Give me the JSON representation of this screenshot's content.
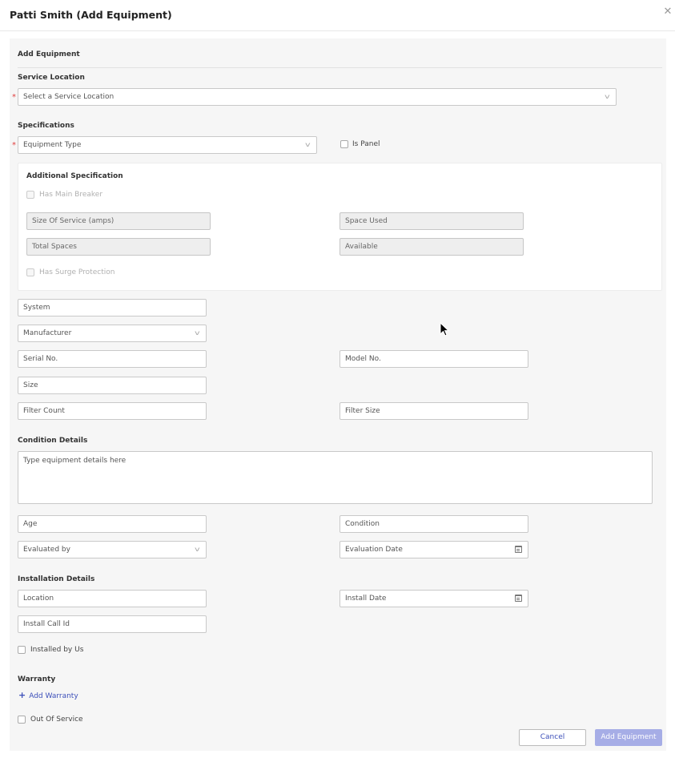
{
  "header": {
    "title": "Patti Smith (Add Equipment)"
  },
  "form": {
    "section_add": "Add Equipment",
    "service_location": {
      "label": "Service Location",
      "placeholder": "Select a Service Location"
    },
    "specifications": {
      "label": "Specifications",
      "equipment_type": "Equipment Type",
      "is_panel": "Is Panel"
    },
    "additional": {
      "title": "Additional Specification",
      "has_main_breaker": "Has Main Breaker",
      "size_of_service": "Size Of Service (amps)",
      "space_used": "Space Used",
      "total_spaces": "Total Spaces",
      "available": "Available",
      "has_surge_protection": "Has Surge Protection"
    },
    "system": "System",
    "manufacturer": "Manufacturer",
    "serial_no": "Serial No.",
    "model_no": "Model No.",
    "size": "Size",
    "filter_count": "Filter Count",
    "filter_size": "Filter Size",
    "condition": {
      "label": "Condition Details",
      "details_placeholder": "Type equipment details here",
      "age": "Age",
      "condition": "Condition",
      "evaluated_by": "Evaluated by",
      "evaluation_date": "Evaluation Date"
    },
    "installation": {
      "label": "Installation Details",
      "location": "Location",
      "install_date": "Install Date",
      "install_call_id": "Install Call Id",
      "installed_by_us": "Installed by Us"
    },
    "warranty": {
      "label": "Warranty",
      "add_warranty": "Add Warranty"
    },
    "out_of_service": "Out Of Service"
  },
  "buttons": {
    "cancel": "Cancel",
    "add_equipment": "Add Equipment"
  },
  "icons": {
    "close": "close-icon",
    "chevron": "chevron-down-icon",
    "calendar": "calendar-icon",
    "plus": "plus-icon",
    "cursor": "mouse-cursor-icon"
  },
  "colors": {
    "accent": "#3c4fb9",
    "primary_button": "#a6ade6",
    "required": "#e04040",
    "panel_bg": "#f6f6f6"
  }
}
